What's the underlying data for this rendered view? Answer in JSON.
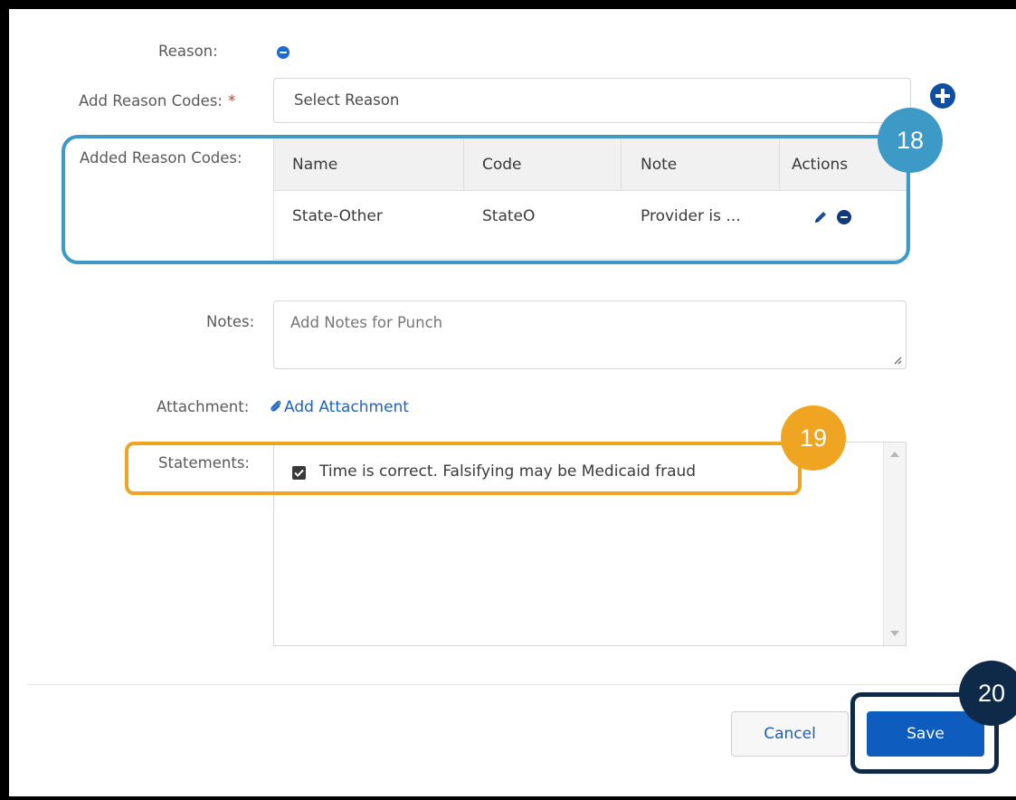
{
  "form": {
    "reason_label": "Reason:",
    "add_reason_codes_label": "Add Reason Codes:",
    "required_marker": "*",
    "select_placeholder": "Select Reason",
    "added_reason_codes_label": "Added Reason Codes:",
    "notes_label": "Notes:",
    "notes_placeholder": "Add Notes for Punch",
    "attachment_label": "Attachment:",
    "add_attachment_link": "Add Attachment",
    "statements_label": "Statements:",
    "statement_text": "Time is correct. Falsifying may be Medicaid fraud",
    "statement_checked": true
  },
  "table": {
    "headers": [
      "Name",
      "Code",
      "Note",
      "Actions"
    ],
    "rows": [
      {
        "name": "State-Other",
        "code": "StateO",
        "note": "Provider is ..."
      }
    ]
  },
  "buttons": {
    "cancel": "Cancel",
    "save": "Save"
  },
  "callouts": {
    "c18": "18",
    "c19": "19",
    "c20": "20"
  },
  "colors": {
    "blue_callout": "#3d9ac6",
    "orange_callout": "#efa521",
    "navy_callout": "#0f2a48",
    "primary": "#0f5cbf"
  },
  "icons": {
    "reason_remove": "minus-circle-icon",
    "add_reason": "plus-circle-icon",
    "edit": "pencil-icon",
    "remove_row": "minus-circle-icon",
    "attachment": "paperclip-icon"
  }
}
